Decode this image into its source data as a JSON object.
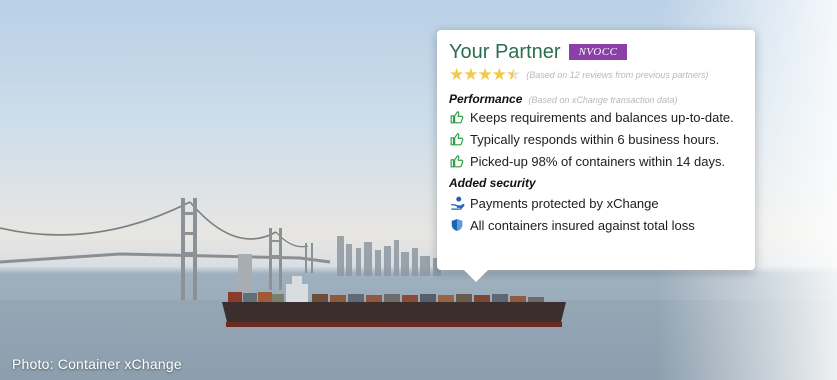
{
  "card": {
    "title": "Your Partner",
    "badge": "NVOCC",
    "rating_value": 4.5,
    "rating_max": 5,
    "reviews_note": "(Based on 12 reviews from previous partners)",
    "performance": {
      "title": "Performance",
      "note": "(Based on xChange transaction data)",
      "items": [
        "Keeps requirements and balances up-to-date.",
        "Typically responds within 6 business hours.",
        "Picked-up 98% of containers within 14 days."
      ]
    },
    "security": {
      "title": "Added security",
      "items": [
        "Payments protected by xChange",
        "All containers insured against total loss"
      ]
    }
  },
  "caption": "Photo: Container xChange",
  "colors": {
    "title_green": "#2b6e4f",
    "badge_purple": "#8d3fa8",
    "star_gold": "#f2c94c",
    "thumb_green": "#2f9e44",
    "shield_blue": "#1e63b5"
  },
  "icons": {
    "performance": "thumbs-up-icon",
    "payments": "hand-coin-icon",
    "insurance": "shield-icon",
    "rating": "star-icon"
  }
}
